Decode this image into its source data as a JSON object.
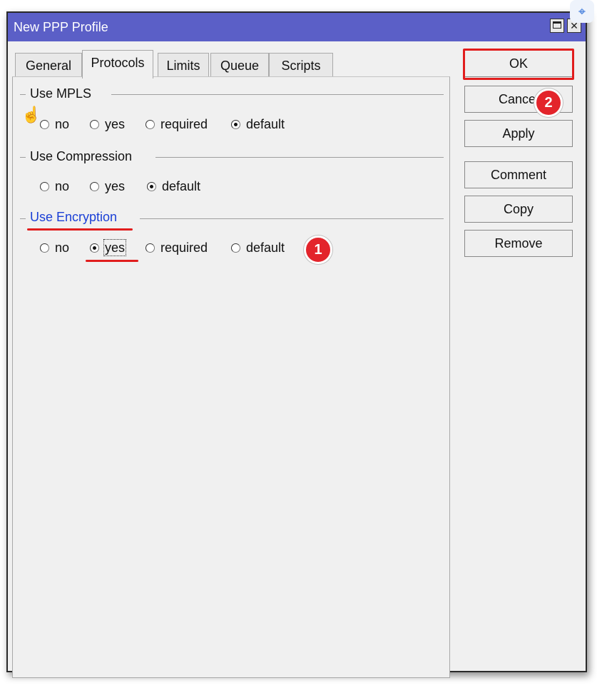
{
  "window": {
    "title": "New PPP Profile",
    "close_glyph": "✕"
  },
  "overlay_icon": "⌖",
  "tabs": [
    {
      "label": "General"
    },
    {
      "label": "Protocols"
    },
    {
      "label": "Limits"
    },
    {
      "label": "Queue"
    },
    {
      "label": "Scripts"
    }
  ],
  "active_tab": "Protocols",
  "groups": {
    "mpls": {
      "title": "Use MPLS",
      "options": [
        "no",
        "yes",
        "required",
        "default"
      ],
      "selected": "default"
    },
    "compression": {
      "title": "Use Compression",
      "options": [
        "no",
        "yes",
        "default"
      ],
      "selected": "default"
    },
    "encryption": {
      "title": "Use Encryption",
      "options": [
        "no",
        "yes",
        "required",
        "default"
      ],
      "selected": "yes"
    }
  },
  "buttons": {
    "ok": "OK",
    "cancel": "Cancel",
    "apply": "Apply",
    "comment": "Comment",
    "copy": "Copy",
    "remove": "Remove"
  },
  "annotations": {
    "step1": "1",
    "step2": "2",
    "highlight_color": "#e11d1d"
  },
  "colors": {
    "titlebar": "#5b5fc7",
    "group_highlight": "#1a3fd6"
  }
}
